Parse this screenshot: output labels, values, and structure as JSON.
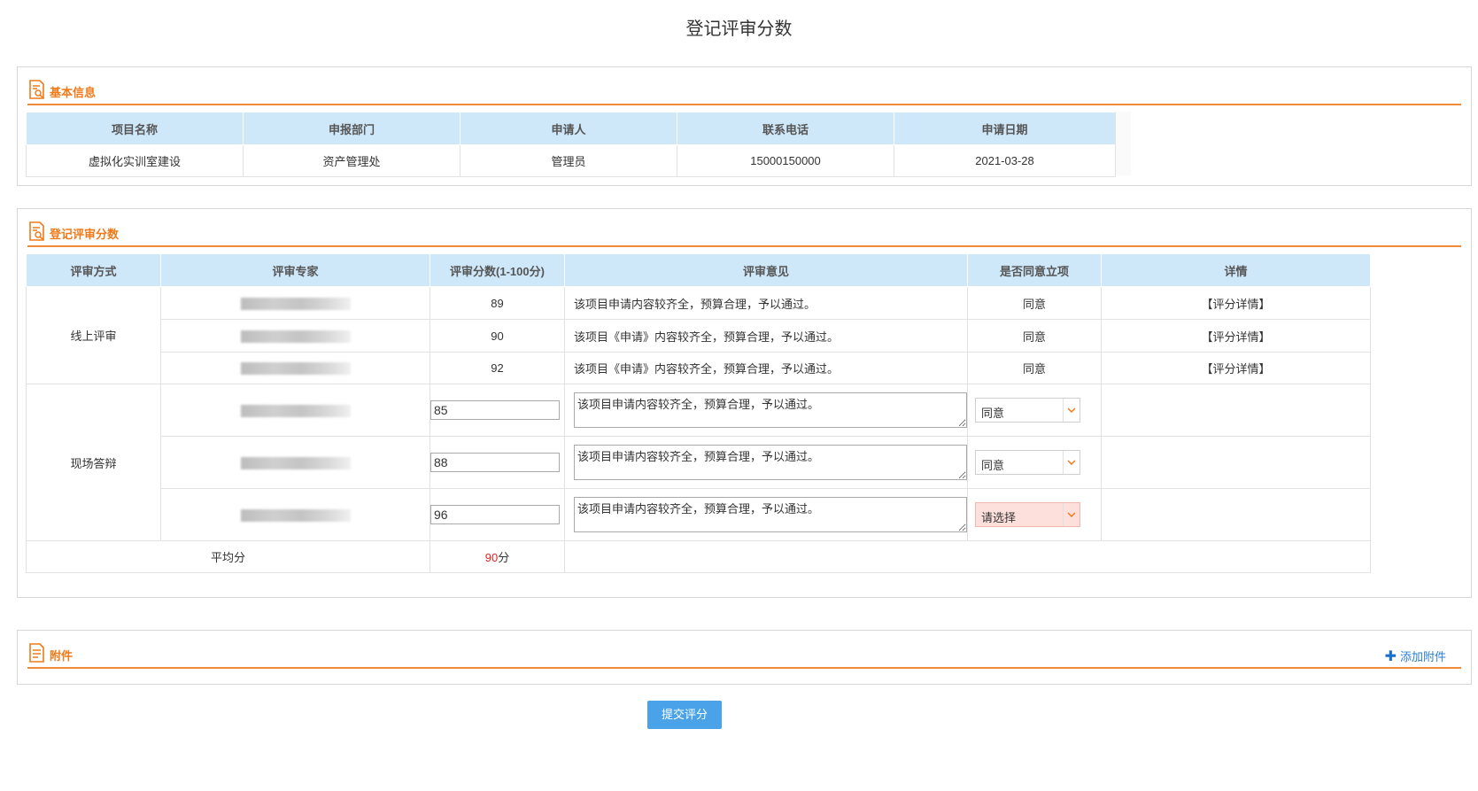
{
  "page": {
    "title": "登记评审分数"
  },
  "basic_info": {
    "section_title": "基本信息",
    "columns": [
      "项目名称",
      "申报部门",
      "申请人",
      "联系电话",
      "申请日期"
    ],
    "row": {
      "project_name": "虚拟化实训室建设",
      "department": "资产管理处",
      "applicant": "管理员",
      "phone": "15000150000",
      "date": "2021-03-28"
    }
  },
  "review": {
    "section_title": "登记评审分数",
    "columns": [
      "评审方式",
      "评审专家",
      "评审分数(1-100分)",
      "评审意见",
      "是否同意立项",
      "详情"
    ],
    "online": {
      "method": "线上评审",
      "rows": [
        {
          "score": "89",
          "opinion": "该项目申请内容较齐全，预算合理，予以通过。",
          "agree": "同意",
          "detail": "【评分详情】"
        },
        {
          "score": "90",
          "opinion": "该项目《申请》内容较齐全，预算合理，予以通过。",
          "agree": "同意",
          "detail": "【评分详情】"
        },
        {
          "score": "92",
          "opinion": "该项目《申请》内容较齐全，预算合理，予以通过。",
          "agree": "同意",
          "detail": "【评分详情】"
        }
      ]
    },
    "onsite": {
      "method": "现场答辩",
      "rows": [
        {
          "score": "85",
          "opinion": "该项目申请内容较齐全，预算合理，予以通过。",
          "agree": "同意"
        },
        {
          "score": "88",
          "opinion": "该项目申请内容较齐全，预算合理，予以通过。",
          "agree": "同意"
        },
        {
          "score": "96",
          "opinion": "该项目申请内容较齐全，预算合理，予以通过。",
          "agree": "请选择"
        }
      ]
    },
    "average": {
      "label": "平均分",
      "value": "90",
      "unit": "分"
    }
  },
  "attachments": {
    "section_title": "附件",
    "add_label": "添加附件"
  },
  "actions": {
    "submit_label": "提交评分"
  },
  "colors": {
    "accent_orange": "#f07a1a",
    "header_blue": "#cfe8f9",
    "link_blue": "#1f6fbf",
    "button_blue": "#4aa3e8",
    "avg_red": "#e02020"
  },
  "icons": [
    "document-search-icon",
    "document-icon",
    "plus-icon",
    "chevron-down-icon"
  ]
}
